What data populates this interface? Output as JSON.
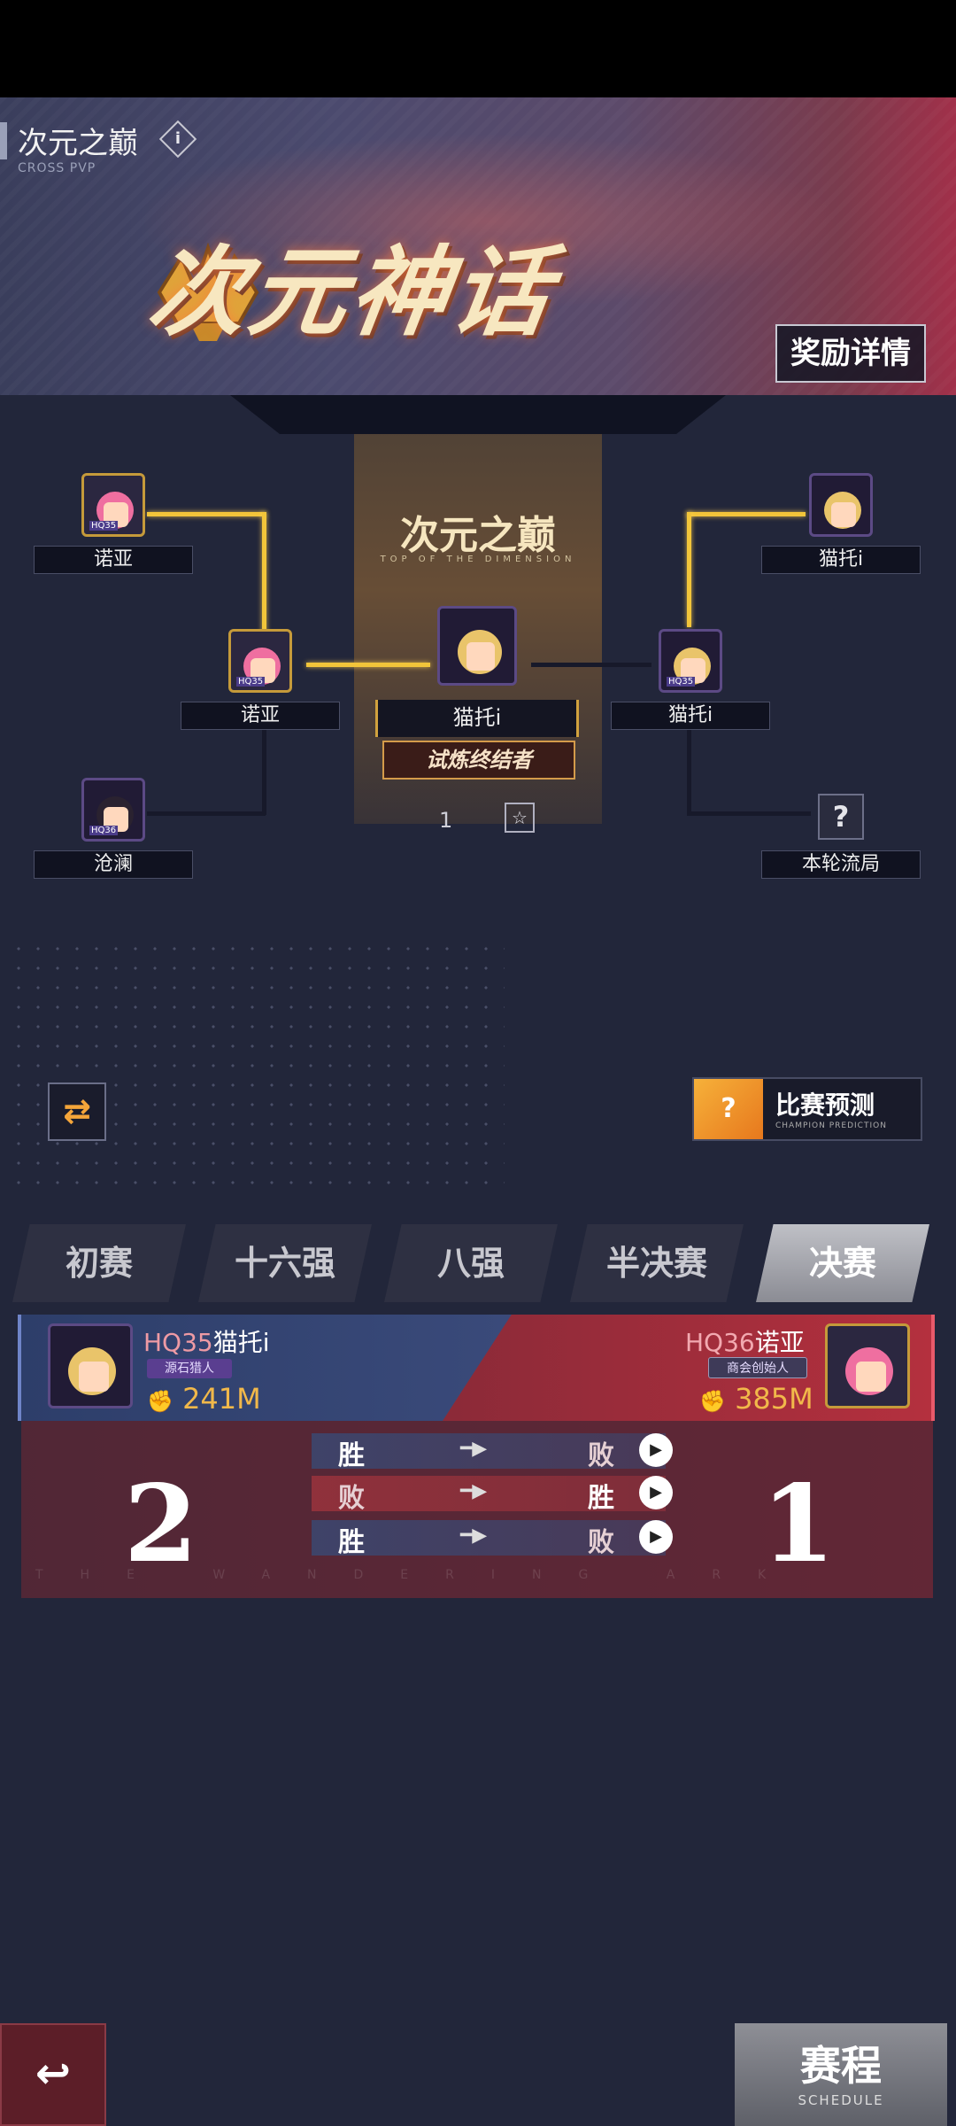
{
  "header": {
    "title": "次元之巅",
    "subtitle": "CROSS PVP",
    "info_icon": "info-icon",
    "banner_logo": "次元神话",
    "reward_button": "奖励详情"
  },
  "bracket": {
    "center_title": "次元之巅",
    "center_subtitle": "TOP OF THE DIMENSION",
    "champion_name": "猫托i",
    "champion_badge": "试炼终结者",
    "champion_count": "1",
    "left_top": "诺亚",
    "left_mid": "诺亚",
    "left_bottom": "沧澜",
    "right_top": "猫托i",
    "right_mid": "猫托i",
    "right_bottom": "本轮流局",
    "unknown_mark": "?",
    "avatar_tags": {
      "left_top": "HQ35",
      "left_mid": "HQ35",
      "left_bottom": "HQ36",
      "right_mid": "HQ35"
    }
  },
  "controls": {
    "swap_icon": "swap-icon",
    "predict_label": "比赛预测",
    "predict_sub": "CHAMPION PREDICTION"
  },
  "tabs": [
    "初赛",
    "十六强",
    "八强",
    "半决赛",
    "决赛"
  ],
  "active_tab": "决赛",
  "match": {
    "left": {
      "hq": "HQ35",
      "name": "猫托i",
      "title": "源石猎人",
      "power": "241M"
    },
    "right": {
      "hq": "HQ36",
      "name": "诺亚",
      "title": "商会创始人",
      "power": "385M"
    },
    "score_left": "2",
    "score_right": "1",
    "rounds": [
      {
        "left": "胜",
        "right": "败"
      },
      {
        "left": "败",
        "right": "胜"
      },
      {
        "left": "胜",
        "right": "败"
      }
    ],
    "watermark": "THE WANDERING ARK"
  },
  "footer": {
    "back_icon": "back-icon",
    "schedule_label": "赛程",
    "schedule_sub": "SCHEDULE"
  },
  "colors": {
    "accent_gold": "#f2c53a",
    "blue_side": "#3a4a7a",
    "red_side": "#b4303e"
  }
}
